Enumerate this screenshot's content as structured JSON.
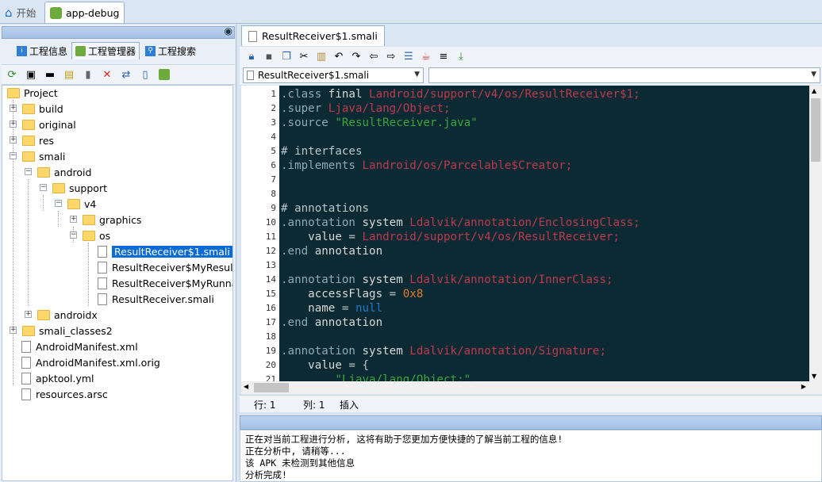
{
  "top_tabs": [
    {
      "label": "开始",
      "icon": "home-icon",
      "active": false
    },
    {
      "label": "app-debug",
      "icon": "android-icon",
      "active": true
    }
  ],
  "left_panel": {
    "tabs": [
      {
        "label": "工程信息",
        "icon": "info-icon"
      },
      {
        "label": "工程管理器",
        "icon": "android-icon"
      },
      {
        "label": "工程搜索",
        "icon": "search-icon"
      }
    ],
    "toolbar_icons": [
      "refresh-icon",
      "image-icon",
      "window-icon",
      "find-folder-icon",
      "book-icon",
      "delete-icon",
      "rename-icon",
      "text-file-icon",
      "android-icon"
    ],
    "tree": {
      "root": "Project",
      "items": [
        {
          "label": "build",
          "type": "folder",
          "expander": "+"
        },
        {
          "label": "original",
          "type": "folder",
          "expander": "+"
        },
        {
          "label": "res",
          "type": "folder",
          "expander": "+"
        },
        {
          "label": "smali",
          "type": "folder",
          "expander": "-"
        },
        {
          "label": "android",
          "type": "folder",
          "expander": "-"
        },
        {
          "label": "support",
          "type": "folder",
          "expander": "-"
        },
        {
          "label": "v4",
          "type": "folder",
          "expander": "-"
        },
        {
          "label": "graphics",
          "type": "folder",
          "expander": "+"
        },
        {
          "label": "os",
          "type": "folder",
          "expander": "-"
        },
        {
          "label": "ResultReceiver$1.smali",
          "type": "file",
          "selected": true
        },
        {
          "label": "ResultReceiver$MyResultR",
          "type": "file"
        },
        {
          "label": "ResultReceiver$MyRunnab",
          "type": "file"
        },
        {
          "label": "ResultReceiver.smali",
          "type": "file"
        },
        {
          "label": "androidx",
          "type": "folder",
          "expander": "+"
        },
        {
          "label": "smali_classes2",
          "type": "folder",
          "expander": "+"
        },
        {
          "label": "AndroidManifest.xml",
          "type": "file"
        },
        {
          "label": "AndroidManifest.xml.orig",
          "type": "file"
        },
        {
          "label": "apktool.yml",
          "type": "file"
        },
        {
          "label": "resources.arsc",
          "type": "file"
        }
      ]
    }
  },
  "editor": {
    "tab_label": "ResultReceiver$1.smali",
    "file_combo": "ResultReceiver$1.smali",
    "member_combo": "",
    "toolbar_icons": [
      "lock-icon",
      "save-icon",
      "copy-icon",
      "cut-icon",
      "paste-icon",
      "undo-icon",
      "redo-icon",
      "back-icon",
      "forward-icon",
      "format-icon",
      "java-icon",
      "list-icon",
      "jump-icon"
    ],
    "lines": [
      {
        "n": "1",
        "parts": [
          [
            "dir",
            ".class "
          ],
          [
            "kw",
            "final "
          ],
          [
            "cls",
            "Landroid/support/v4/os/ResultReceiver$1;"
          ]
        ]
      },
      {
        "n": "2",
        "parts": [
          [
            "dir",
            ".super "
          ],
          [
            "cls",
            "Ljava/lang/Object;"
          ]
        ]
      },
      {
        "n": "3",
        "parts": [
          [
            "dir",
            ".source "
          ],
          [
            "str",
            "\"ResultReceiver.java\""
          ]
        ]
      },
      {
        "n": "4",
        "parts": []
      },
      {
        "n": "5",
        "parts": [
          [
            "cmt",
            "# interfaces"
          ]
        ]
      },
      {
        "n": "6",
        "parts": [
          [
            "dir",
            ".implements "
          ],
          [
            "cls",
            "Landroid/os/Parcelable$Creator;"
          ]
        ]
      },
      {
        "n": "7",
        "parts": []
      },
      {
        "n": "8",
        "parts": []
      },
      {
        "n": "9",
        "parts": [
          [
            "cmt",
            "# annotations"
          ]
        ]
      },
      {
        "n": "10",
        "parts": [
          [
            "dir",
            ".annotation "
          ],
          [
            "kw",
            "system "
          ],
          [
            "cls",
            "Ldalvik/annotation/EnclosingClass;"
          ]
        ]
      },
      {
        "n": "11",
        "parts": [
          [
            "kw",
            "    value "
          ],
          [
            "op",
            "= "
          ],
          [
            "cls",
            "Landroid/support/v4/os/ResultReceiver;"
          ]
        ]
      },
      {
        "n": "12",
        "parts": [
          [
            "dir",
            ".end "
          ],
          [
            "kw",
            "annotation"
          ]
        ]
      },
      {
        "n": "13",
        "parts": []
      },
      {
        "n": "14",
        "parts": [
          [
            "dir",
            ".annotation "
          ],
          [
            "kw",
            "system "
          ],
          [
            "cls",
            "Ldalvik/annotation/InnerClass;"
          ]
        ]
      },
      {
        "n": "15",
        "parts": [
          [
            "kw",
            "    accessFlags "
          ],
          [
            "op",
            "= "
          ],
          [
            "num",
            "0x8"
          ]
        ]
      },
      {
        "n": "16",
        "parts": [
          [
            "kw",
            "    name "
          ],
          [
            "op",
            "= "
          ],
          [
            "kw2",
            "null"
          ]
        ]
      },
      {
        "n": "17",
        "parts": [
          [
            "dir",
            ".end "
          ],
          [
            "kw",
            "annotation"
          ]
        ]
      },
      {
        "n": "18",
        "parts": []
      },
      {
        "n": "19",
        "parts": [
          [
            "dir",
            ".annotation "
          ],
          [
            "kw",
            "system "
          ],
          [
            "cls",
            "Ldalvik/annotation/Signature;"
          ]
        ]
      },
      {
        "n": "20",
        "parts": [
          [
            "kw",
            "    value "
          ],
          [
            "op",
            "= {"
          ]
        ]
      },
      {
        "n": "21",
        "parts": [
          [
            "str",
            "        \"Ljava/lang/Object;\","
          ]
        ]
      }
    ]
  },
  "status": {
    "row": "行: 1",
    "col": "列: 1",
    "mode": "插入"
  },
  "output": [
    "正在对当前工程进行分析, 这将有助于您更加方便快捷的了解当前工程的信息!",
    "正在分析中, 请稍等...",
    "该 APK 未检测到其他信息",
    "分析完成!"
  ],
  "colors": {
    "accent": "#0a6ad6",
    "code_bg": "#0b2a33",
    "string": "#3aa63a",
    "class_ref": "#c03a4e"
  }
}
